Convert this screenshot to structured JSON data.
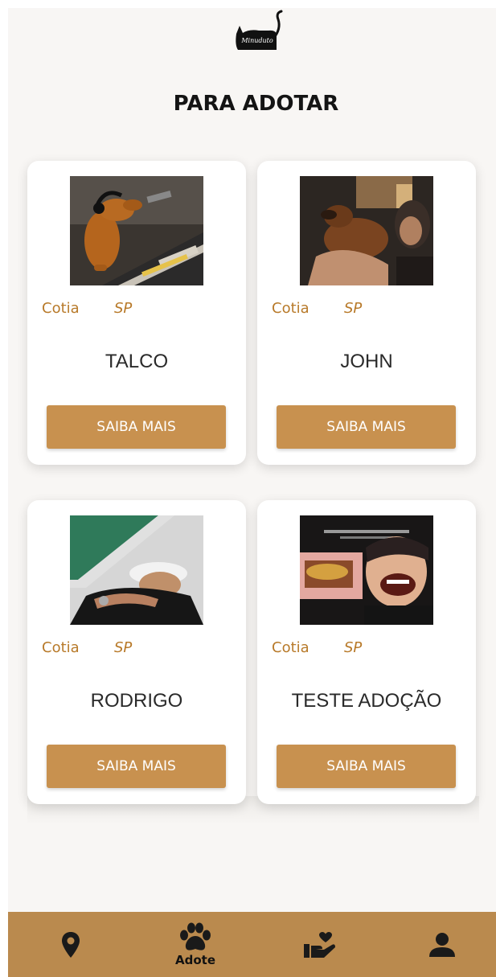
{
  "app": {
    "logo_text": "Minuduto",
    "page_title": "PARA ADOTAR"
  },
  "colors": {
    "accent": "#c8914f",
    "nav_background": "#ba8a4e",
    "location_text": "#b87a2a",
    "background": "#f8f6f4"
  },
  "pets": [
    {
      "city": "Cotia",
      "state": "SP",
      "name": "TALCO",
      "button_label": "SAIBA MAIS",
      "photo": "dog-with-headphones-at-mixing-console"
    },
    {
      "city": "Cotia",
      "state": "SP",
      "name": "JOHN",
      "button_label": "SAIBA MAIS",
      "photo": "man-holding-dog"
    },
    {
      "city": "Cotia",
      "state": "SP",
      "name": "RODRIGO",
      "button_label": "SAIBA MAIS",
      "photo": "person-in-white-cap"
    },
    {
      "city": "Cotia",
      "state": "SP",
      "name": "TESTE ADOÇÃO",
      "button_label": "SAIBA MAIS",
      "photo": "man-laughing-holding-box"
    }
  ],
  "bottom_nav": {
    "items": [
      {
        "icon": "map-pin-icon",
        "label": ""
      },
      {
        "icon": "paw-icon",
        "label": "Adote",
        "active": true
      },
      {
        "icon": "donate-heart-hand-icon",
        "label": ""
      },
      {
        "icon": "user-icon",
        "label": ""
      }
    ]
  }
}
